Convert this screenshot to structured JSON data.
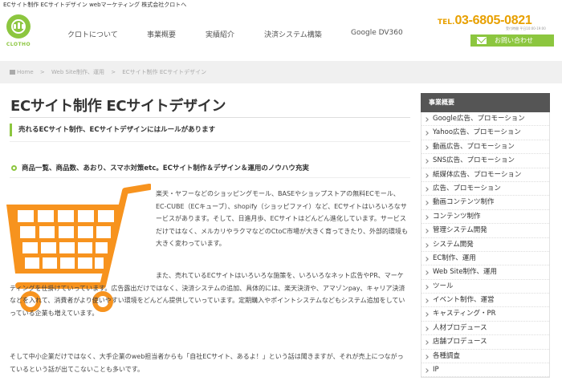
{
  "topbar": {
    "text": "ECサイト制作 ECサイトデザイン webマーケティング 株式会社クロトへ"
  },
  "logo": {
    "text": "CLOTHO"
  },
  "nav": {
    "items": [
      "クロトについて",
      "事業概要",
      "実績紹介",
      "決済システム構築",
      "Google DV360"
    ]
  },
  "contact": {
    "tel_label": "TEL.",
    "tel": "03-6805-0821",
    "tel_sub": "受付時間 平日10:00-19:00",
    "button_label": "お問い合わせ"
  },
  "breadcrumb": [
    "Home",
    "Web Site制作、運用",
    "ECサイト制作 ECサイトデザイン"
  ],
  "main": {
    "title": "ECサイト制作 ECサイトデザイン",
    "lead": "売れるECサイト制作、ECサイトデザインにはルールがあります",
    "h3": "商品一覧、商品数、あおり、スマホ対策etc。ECサイト制作＆デザイン＆運用のノウハウ充実",
    "p1": "楽天・ヤフーなどのショッピングモール、BASEやショップストアの無料ECモール、EC-CUBE（ECキューブ）、shopify（ショッピファイ）など、ECサイトはいろいろなサービスがあります。そして、日進月歩、ECサイトはどんどん進化しています。サービスだけではなく、メルカリやラクマなどのCtoC市場が大きく育ってきたり、外部的環境も大きく変わっています。",
    "p2": "また、売れているECサイトはいろいろな施策を、いろいろなネット広告やPR、マーケティングを仕掛けていっています。広告露出だけではなく、決済システムの追加、具体的には、楽天決済や、アマゾンpay、キャリア決済などを入れて、消費者がより使いやすい環境をどんどん提供していっています。定期購入やポイントシステムなどもシステム追加をしていっている企業も増えています。",
    "p3": "そして中小企業だけではなく、大手企業のweb担当者からも「自社ECサイト、あるよ！」という話は聞きますが、それが売上につながっているという話が出てこないことも多いです。"
  },
  "sidebar": {
    "title": "事業概要",
    "items": [
      "Google広告、プロモーション",
      "Yahoo広告、プロモーション",
      "動画広告、プロモーション",
      "SNS広告、プロモーション",
      "紙媒体広告、プロモーション",
      "広告、プロモーション",
      "動画コンテンツ制作",
      "コンテンツ制作",
      "管理システム開発",
      "システム開発",
      "EC制作、運用",
      "Web Site制作、運用",
      "ツール",
      "イベント制作、運営",
      "キャスティング・PR",
      "人材プロデュース",
      "店舗プロデュース",
      "各種調査",
      "IP"
    ]
  },
  "colors": {
    "accent": "#8cc63f",
    "tel": "#e8a000",
    "cart": "#f7931e"
  },
  "icons": [
    "home-icon",
    "mail-icon",
    "shopping-cart-icon",
    "chevron-right-icon"
  ]
}
